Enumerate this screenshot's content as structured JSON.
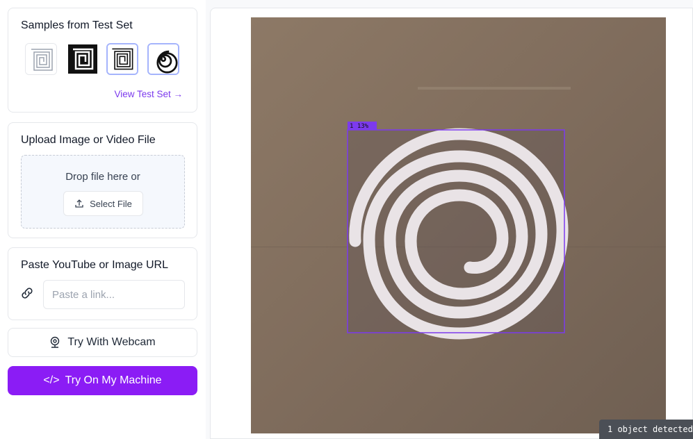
{
  "samples": {
    "title": "Samples from Test Set",
    "view_link": "View Test Set →",
    "thumbnails": [
      {
        "icon": "square-spiral-light"
      },
      {
        "icon": "square-spiral-dark"
      },
      {
        "icon": "square-spiral-outline"
      },
      {
        "icon": "round-spiral"
      }
    ]
  },
  "upload": {
    "title": "Upload Image or Video File",
    "drop_text": "Drop file here or",
    "select_label": "Select File"
  },
  "paste": {
    "title": "Paste YouTube or Image URL",
    "placeholder": "Paste a link..."
  },
  "webcam": {
    "label": "Try With Webcam"
  },
  "machine": {
    "icon": "</>",
    "label": "Try On My Machine"
  },
  "detection": {
    "label": "1 13%",
    "color": "#7c3aed"
  },
  "status": {
    "text": "1 object detected"
  },
  "colors": {
    "accent": "#8b1cf5",
    "link": "#7c3aed",
    "box": "#7c3aed"
  }
}
